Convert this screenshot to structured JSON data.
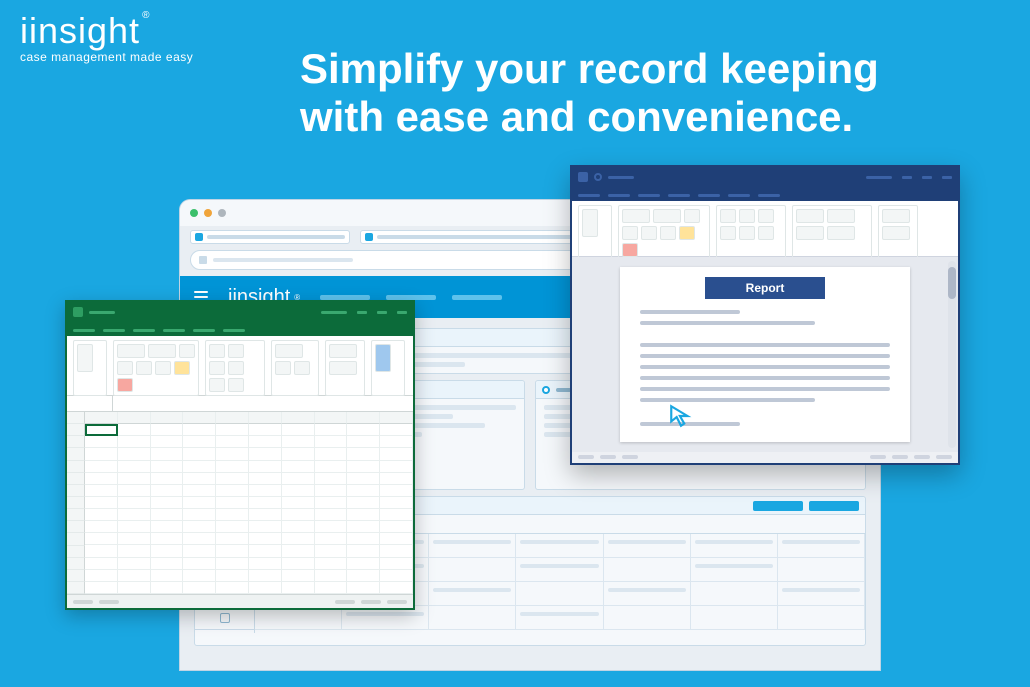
{
  "logo": {
    "brand": "iinsight",
    "reg": "®",
    "tagline": "case management made easy"
  },
  "headline": {
    "line1": "Simplify your record keeping",
    "line2": "with ease and convenience."
  },
  "browser": {
    "app_brand": "iinsight",
    "app_reg": "®"
  },
  "word": {
    "doc_title": "Report"
  },
  "colors": {
    "background": "#1aa7e1",
    "excel_brand": "#0c6b3a",
    "word_brand": "#1f3f77",
    "app_brand": "#0094d6",
    "legend_orange": "#f0a43a",
    "legend_green": "#3bbf6b",
    "legend_blue": "#0094d6"
  }
}
